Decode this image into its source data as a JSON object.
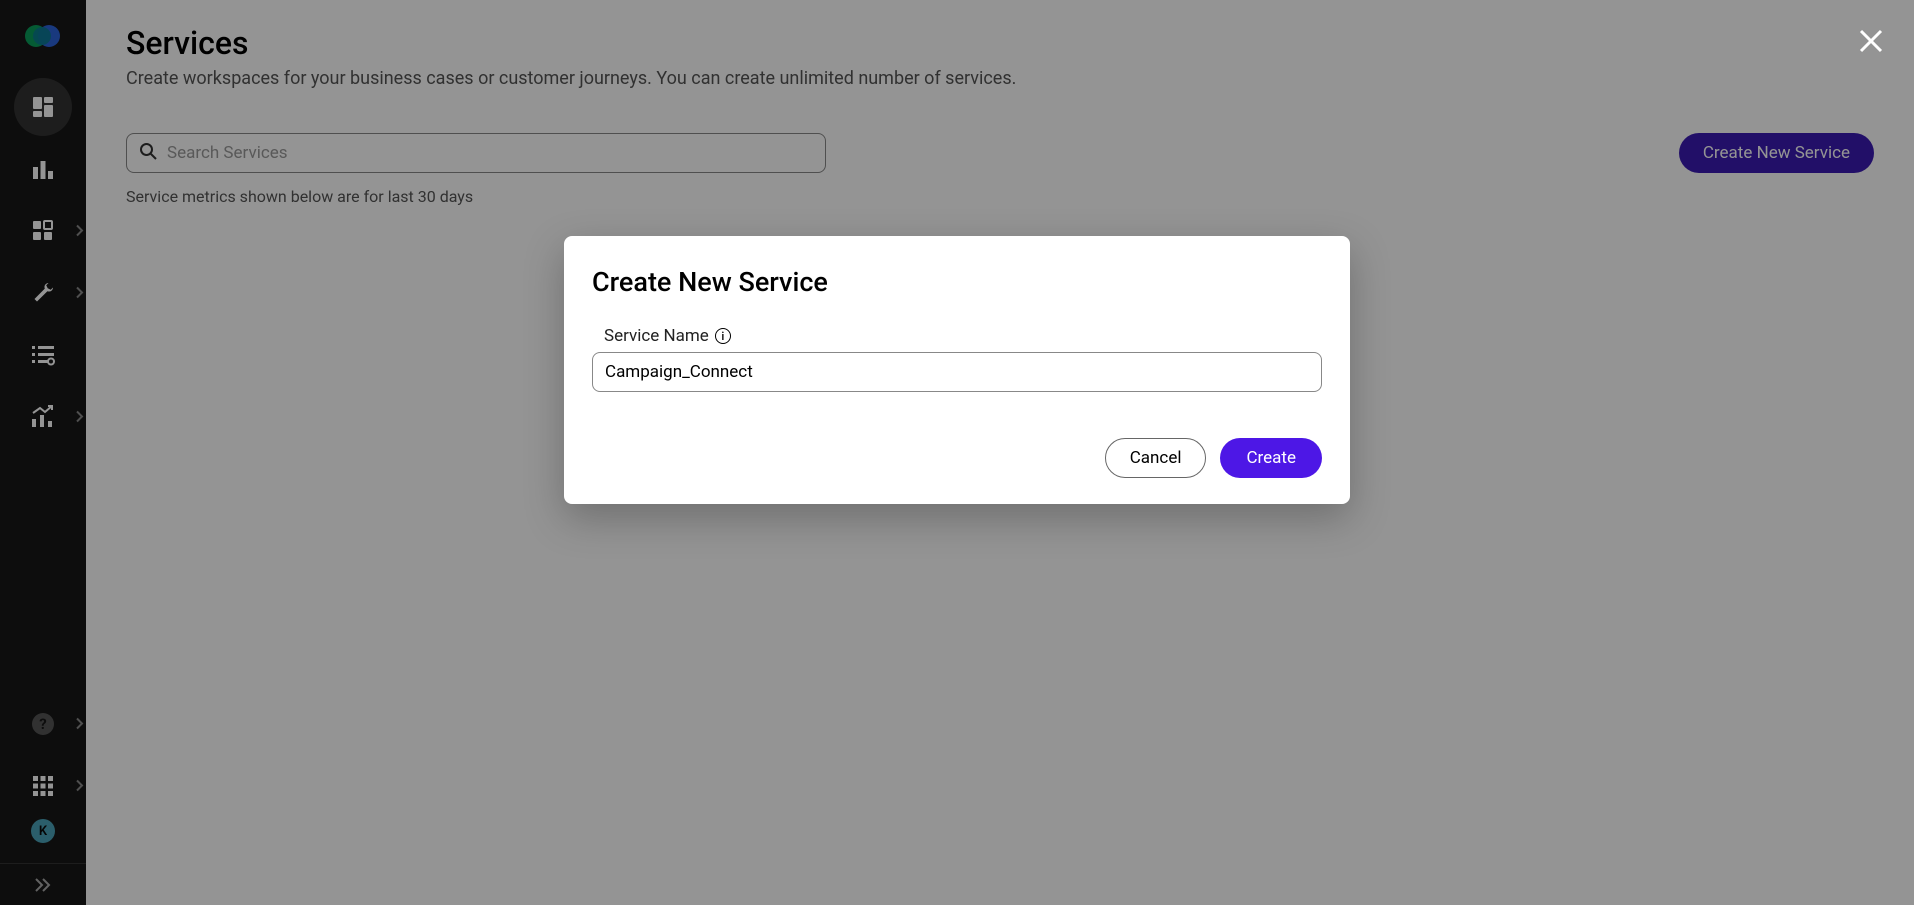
{
  "sidebar": {
    "avatar_initial": "K"
  },
  "header": {
    "title": "Services",
    "subtitle": "Create workspaces for your business cases or customer journeys. You can create unlimited number of services."
  },
  "toolbar": {
    "search_placeholder": "Search Services",
    "create_label": "Create New Service"
  },
  "metrics_note": "Service metrics shown below are for last 30 days",
  "modal": {
    "title": "Create New Service",
    "field_label": "Service Name",
    "field_value": "Campaign_Connect",
    "cancel_label": "Cancel",
    "create_label": "Create"
  }
}
